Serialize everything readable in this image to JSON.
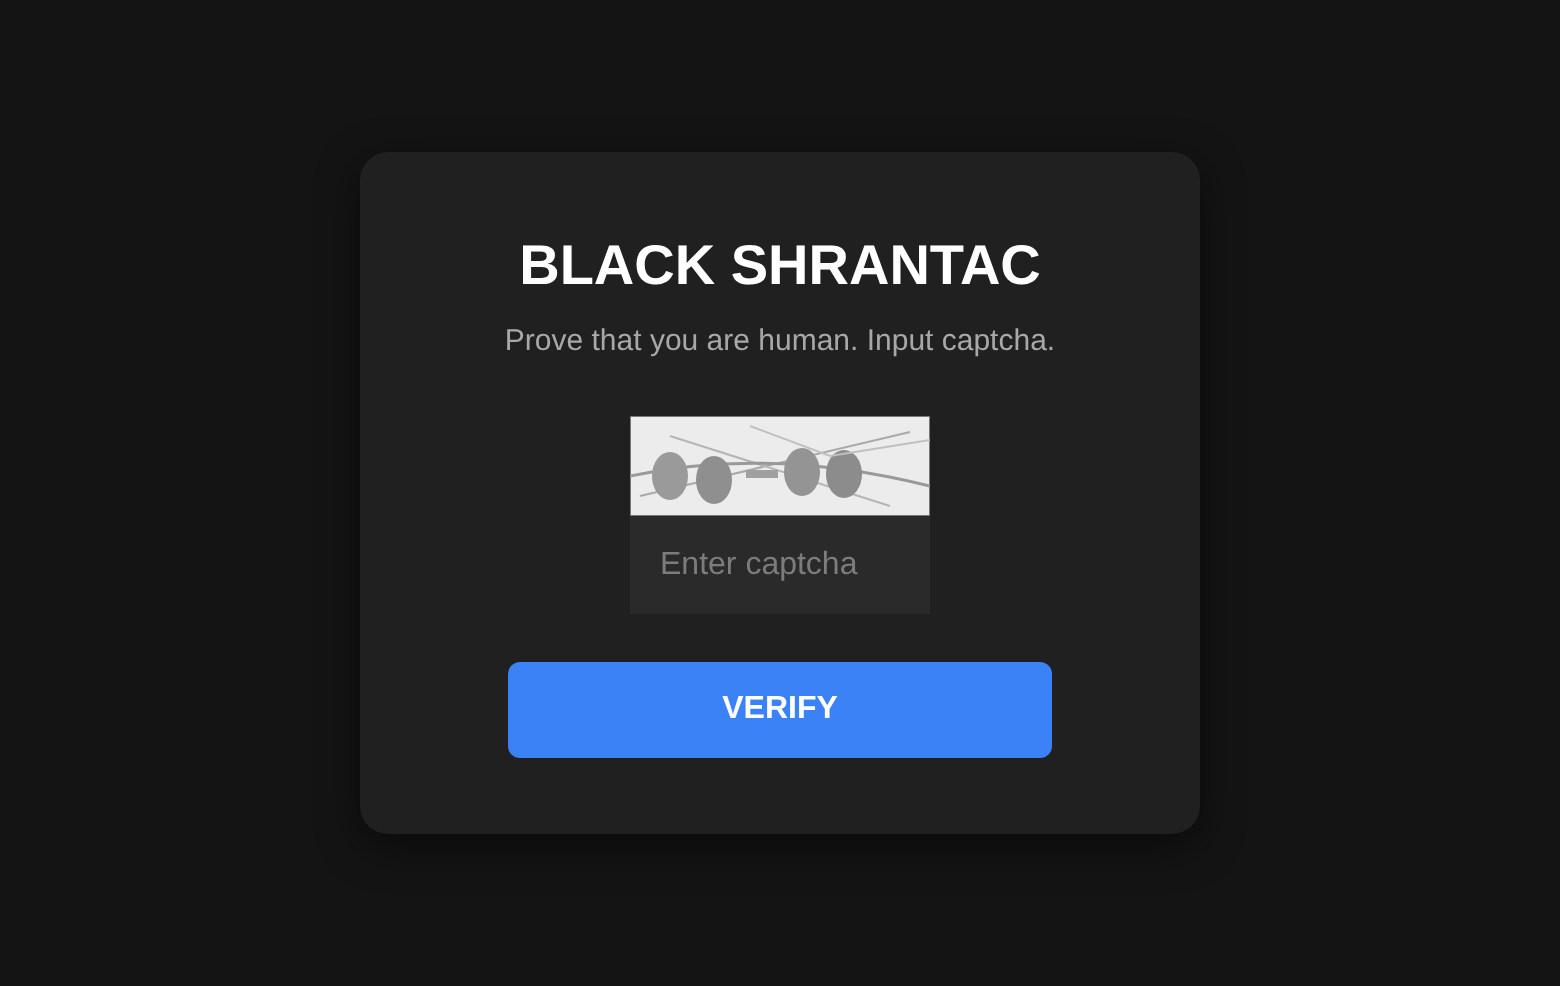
{
  "card": {
    "title": "BLACK SHRANTAC",
    "subtitle": "Prove that you are human. Input captcha.",
    "input": {
      "placeholder": "Enter captcha"
    },
    "button": "VERIFY"
  }
}
